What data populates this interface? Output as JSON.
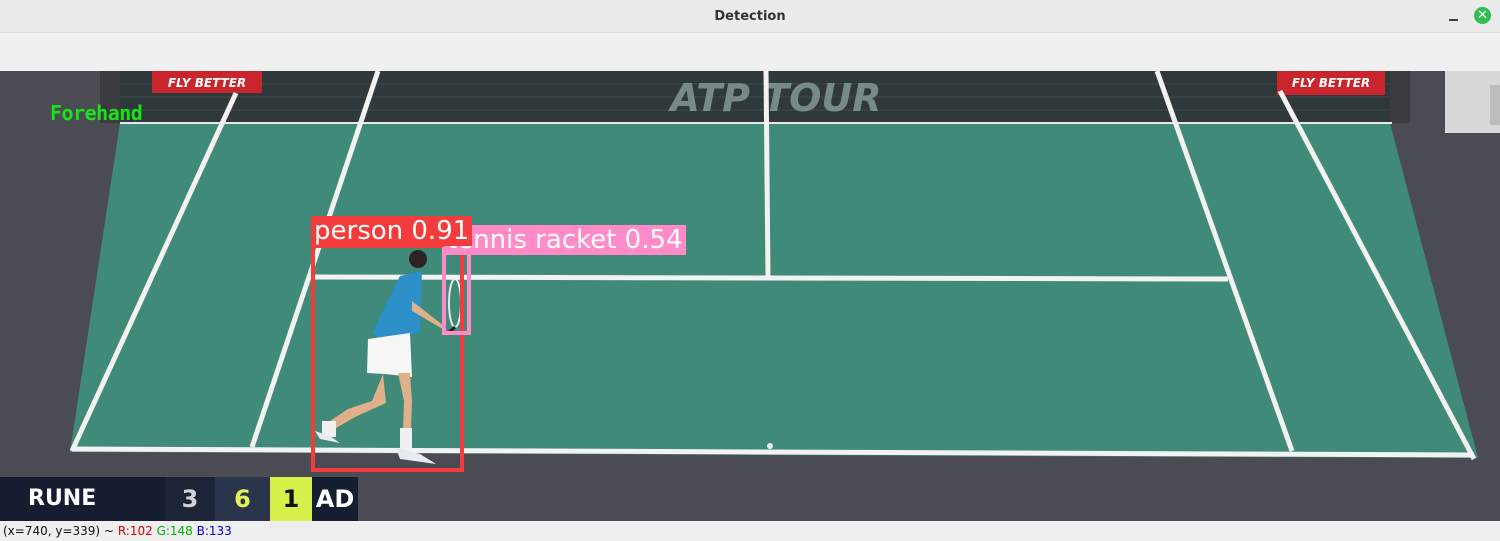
{
  "window": {
    "title": "Detection"
  },
  "overlay": {
    "action_label": "Forehand",
    "detections": [
      {
        "label": "person 0.91",
        "color": "#f53c3c"
      },
      {
        "label": "tennis racket 0.54",
        "color": "#ff8cc8"
      }
    ]
  },
  "scene": {
    "banner_left": "FLY BETTER",
    "banner_right": "FLY BETTER",
    "net_logo": "ATP TOUR"
  },
  "scoreboard": {
    "player": "RUNE",
    "set1": "3",
    "set2": "6",
    "game": "1",
    "point": "AD"
  },
  "status": {
    "coords": "(x=740, y=339) ~",
    "r": "R:102",
    "g": "G:148",
    "b": "B:133"
  },
  "colors": {
    "court": "#3f8a78",
    "floor": "#4a4a52",
    "person_box": "#f53c3c",
    "racket_box": "#ff8cc8",
    "action_text": "#18e318"
  }
}
